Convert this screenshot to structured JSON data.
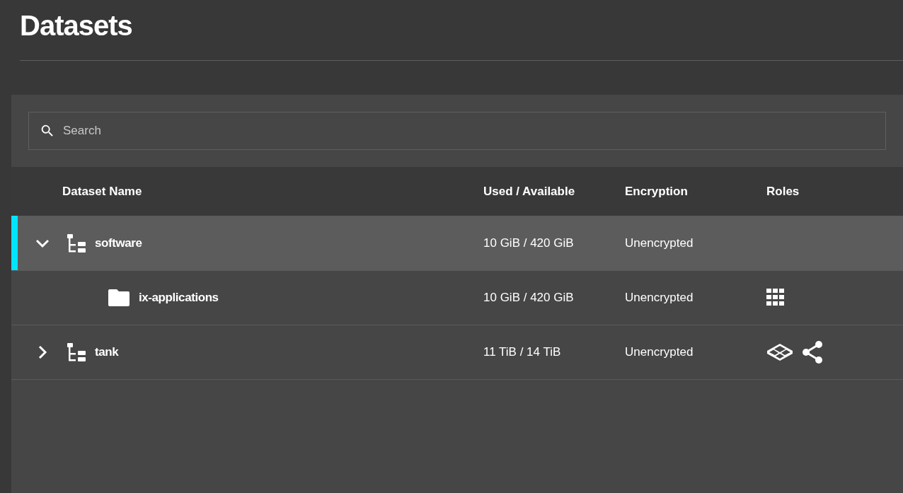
{
  "page": {
    "title": "Datasets"
  },
  "search": {
    "placeholder": "Search"
  },
  "table": {
    "columns": [
      "Dataset Name",
      "Used / Available",
      "Encryption",
      "Roles"
    ],
    "rows": [
      {
        "name": "software",
        "kind": "pool",
        "expanded": true,
        "selected": true,
        "used": "10 GiB / 420 GiB",
        "encryption": "Unencrypted",
        "roles": [],
        "children": [
          {
            "name": "ix-applications",
            "kind": "dataset",
            "selected": false,
            "used": "10 GiB / 420 GiB",
            "encryption": "Unencrypted",
            "roles": [
              {
                "kind": "apps"
              }
            ]
          }
        ]
      },
      {
        "name": "tank",
        "kind": "pool",
        "expanded": false,
        "selected": false,
        "used": "11 TiB / 14 TiB",
        "encryption": "Unencrypted",
        "roles": [
          {
            "kind": "storage"
          },
          {
            "kind": "share"
          }
        ]
      }
    ]
  }
}
